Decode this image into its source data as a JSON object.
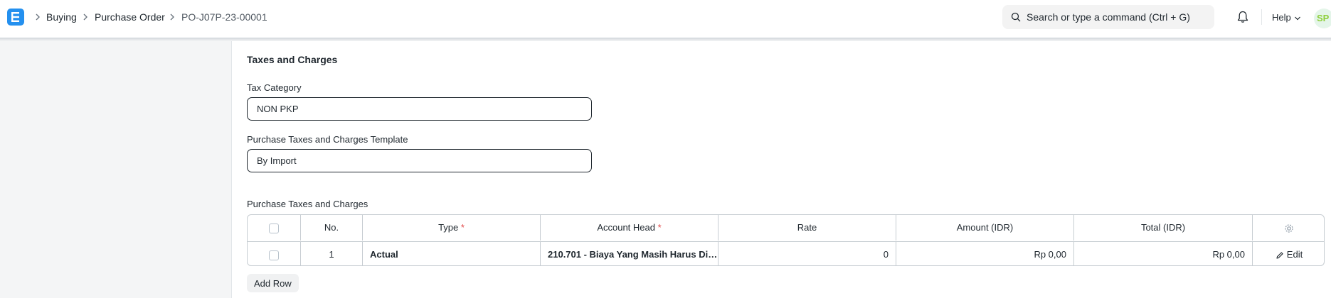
{
  "navbar": {
    "logo_letter": "E",
    "breadcrumbs": [
      "Buying",
      "Purchase Order",
      "PO-J07P-23-00001"
    ],
    "search_placeholder": "Search or type a command (Ctrl + G)",
    "help_label": "Help",
    "avatar_initials": "SP"
  },
  "section": {
    "title": "Taxes and Charges",
    "tax_category": {
      "label": "Tax Category",
      "value": "NON PKP"
    },
    "template": {
      "label": "Purchase Taxes and Charges Template",
      "value": "By Import"
    },
    "table_label": "Purchase Taxes and Charges",
    "table": {
      "columns": [
        "No.",
        "Type",
        "Account Head",
        "Rate",
        "Amount (IDR)",
        "Total (IDR)"
      ],
      "required_columns": [
        "Type",
        "Account Head"
      ],
      "rows": [
        {
          "no": "1",
          "type": "Actual",
          "account_head": "210.701 - Biaya Yang Masih Harus Dib...",
          "rate": "0",
          "amount": "Rp 0,00",
          "total": "Rp 0,00",
          "action": "Edit"
        }
      ]
    },
    "add_row_label": "Add Row"
  },
  "colors": {
    "brand": "#2490ef",
    "required_star": "#e24c4c",
    "avatar_text": "#8ecf3b"
  },
  "icons": [
    "app-logo",
    "chevron-right-icon",
    "search-icon",
    "bell-icon",
    "chevron-down-icon",
    "gear-icon",
    "pencil-icon"
  ]
}
